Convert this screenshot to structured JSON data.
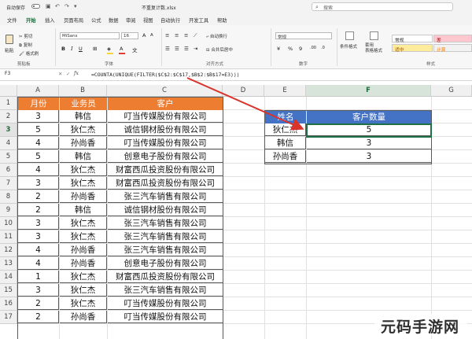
{
  "titlebar": {
    "autosave_label": "自动保存",
    "doc_title": "不重复计数.xlsx",
    "search_placeholder": "搜索"
  },
  "tabs": [
    "文件",
    "开始",
    "插入",
    "页面布局",
    "公式",
    "数据",
    "审阅",
    "视图",
    "自动执行",
    "开发工具",
    "帮助"
  ],
  "active_tab": "开始",
  "ribbon": {
    "paste": "粘贴",
    "cut": "剪切",
    "copy": "复制",
    "format_painter": "格式刷",
    "font_name": "MiSans",
    "font_size": "16",
    "wrap_text": "自动换行",
    "merge_center": "合并后居中",
    "number_format": "常规",
    "conditional_format": "条件格式",
    "table_format": "套用\n表格格式",
    "style_normal": "常规",
    "style_bad": "差",
    "style_neutral": "适中",
    "style_calc": "计算",
    "group_clipboard": "剪贴板",
    "group_font": "字体",
    "group_align": "对齐方式",
    "group_number": "数字",
    "group_styles": "样式"
  },
  "formula_bar": {
    "cell_ref": "F3",
    "formula": "=COUNTA(UNIQUE(FILTER($C$2:$C$17,$B$2:$B$17=E3)))"
  },
  "columns": [
    "A",
    "B",
    "C",
    "D",
    "E",
    "F",
    "G"
  ],
  "rows": [
    "1",
    "2",
    "3",
    "4",
    "5",
    "6",
    "7",
    "8",
    "9",
    "10",
    "11",
    "12",
    "13",
    "14",
    "15",
    "16",
    "17"
  ],
  "table": {
    "headers": [
      "月份",
      "业务员",
      "客户"
    ],
    "rows": [
      [
        "3",
        "韩信",
        "叮当传媒股份有限公司"
      ],
      [
        "5",
        "狄仁杰",
        "诚信钢材股份有限公司"
      ],
      [
        "4",
        "孙尚香",
        "叮当传媒股份有限公司"
      ],
      [
        "5",
        "韩信",
        "创意电子股份有限公司"
      ],
      [
        "4",
        "狄仁杰",
        "财富西瓜投资股份有限公司"
      ],
      [
        "3",
        "狄仁杰",
        "财富西瓜投资股份有限公司"
      ],
      [
        "2",
        "孙尚香",
        "张三汽车销售有限公司"
      ],
      [
        "2",
        "韩信",
        "诚信钢材股份有限公司"
      ],
      [
        "3",
        "狄仁杰",
        "张三汽车销售有限公司"
      ],
      [
        "3",
        "狄仁杰",
        "张三汽车销售有限公司"
      ],
      [
        "4",
        "孙尚香",
        "张三汽车销售有限公司"
      ],
      [
        "4",
        "孙尚香",
        "创意电子股份有限公司"
      ],
      [
        "1",
        "狄仁杰",
        "财富西瓜投资股份有限公司"
      ],
      [
        "3",
        "狄仁杰",
        "张三汽车销售有限公司"
      ],
      [
        "2",
        "狄仁杰",
        "叮当传媒股份有限公司"
      ],
      [
        "2",
        "孙尚香",
        "叮当传媒股份有限公司"
      ]
    ]
  },
  "summary": {
    "headers": [
      "姓名",
      "客户数量"
    ],
    "rows": [
      [
        "狄仁杰",
        "5"
      ],
      [
        "韩信",
        "3"
      ],
      [
        "孙尚香",
        "3"
      ]
    ]
  },
  "watermark": "元码手游网",
  "colors": {
    "header_orange": "#ed7d31",
    "header_blue": "#4472c4",
    "excel_green": "#1e7145",
    "arrow_red": "#d9342b"
  }
}
